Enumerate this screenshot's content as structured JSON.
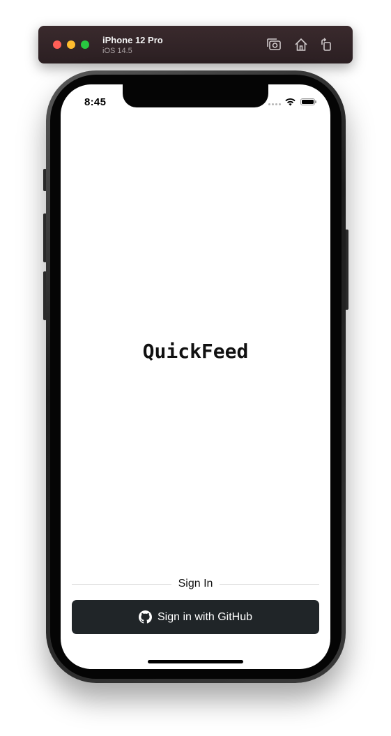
{
  "simulator": {
    "device_name": "iPhone 12 Pro",
    "os_version": "iOS 14.5",
    "toolbar_icons": [
      "screenshot-icon",
      "home-icon",
      "rotate-icon"
    ]
  },
  "status_bar": {
    "time": "8:45",
    "icons": [
      "cellular-dots-icon",
      "wifi-icon",
      "battery-icon"
    ]
  },
  "app": {
    "title": "QuickFeed"
  },
  "sign_in": {
    "divider_label": "Sign In",
    "github_button_label": "Sign in with GitHub",
    "github_button_icon": "github-icon",
    "button_color": "#202528"
  }
}
